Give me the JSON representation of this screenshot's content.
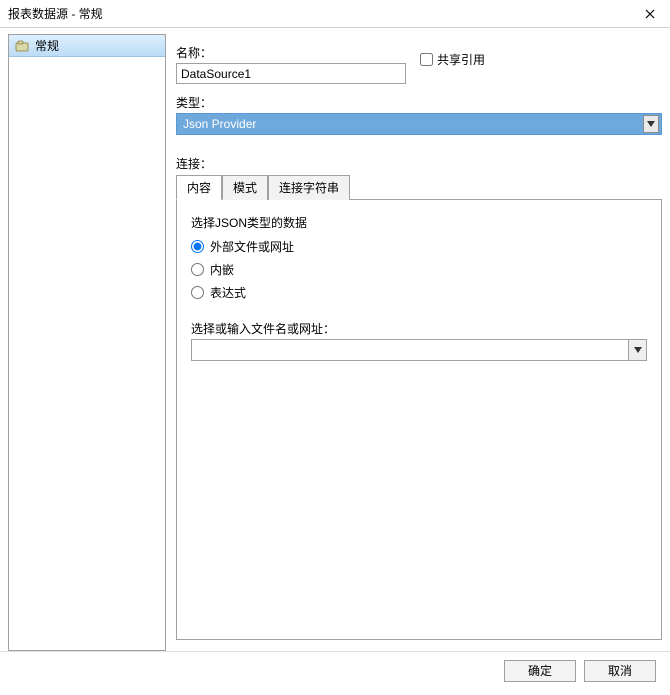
{
  "window": {
    "title": "报表数据源 - 常规"
  },
  "sidebar": {
    "items": [
      {
        "label": "常规"
      }
    ]
  },
  "main": {
    "name_label": "名称：",
    "name_value": "DataSource1",
    "shared_ref_label": "共享引用",
    "type_label": "类型：",
    "type_value": "Json Provider",
    "connection_label": "连接：",
    "tabs": [
      {
        "label": "内容",
        "active": true
      },
      {
        "label": "模式",
        "active": false
      },
      {
        "label": "连接字符串",
        "active": false
      }
    ],
    "content_tab": {
      "json_type_label": "选择JSON类型的数据",
      "radios": [
        {
          "label": "外部文件或网址",
          "checked": true
        },
        {
          "label": "内嵌",
          "checked": false
        },
        {
          "label": "表达式",
          "checked": false
        }
      ],
      "file_label": "选择或输入文件名或网址：",
      "file_value": ""
    }
  },
  "footer": {
    "ok_label": "确定",
    "cancel_label": "取消"
  }
}
